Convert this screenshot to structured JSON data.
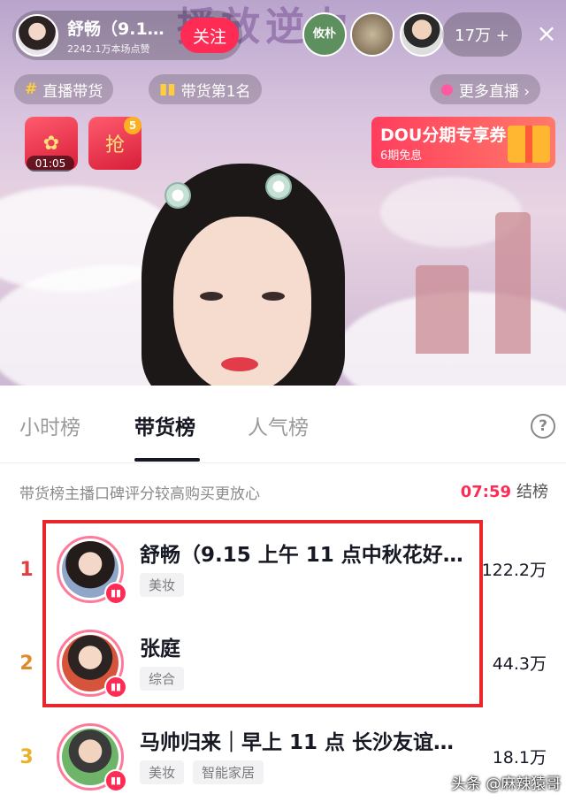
{
  "stream": {
    "banner_text": "播放逆力",
    "host": {
      "name": "舒畅（9.1…",
      "likes": "2242.1万本场点赞",
      "follow_label": "关注"
    },
    "viewer_badge": "攸朴",
    "viewer_count": "17万 +",
    "close_icon": "×",
    "chips": [
      {
        "icon": "#",
        "label": "直播带货"
      },
      {
        "icon": "▮▮",
        "label": "带货第1名"
      },
      {
        "icon": "●",
        "label": "更多直播 ›"
      }
    ],
    "gift_timer": "01:05",
    "gift_badge_count": "5",
    "gift2_label": "抢",
    "promo": {
      "title": "DOU分期专享券",
      "subtitle": "6期免息"
    }
  },
  "panel": {
    "tabs": [
      {
        "label": "小时榜"
      },
      {
        "label": "带货榜"
      },
      {
        "label": "人气榜"
      }
    ],
    "help_icon": "?",
    "subheading": "带货榜主播口碑评分较高购买更放心",
    "countdown_time": "07:59",
    "countdown_label": "结榜",
    "rows": [
      {
        "rank": "1",
        "name": "舒畅（9.15 上午 11 点中秋花好…",
        "tags": [
          "美妆"
        ],
        "metric": "122.2万"
      },
      {
        "rank": "2",
        "name": "张庭",
        "tags": [
          "综合"
        ],
        "metric": "44.3万"
      },
      {
        "rank": "3",
        "name": "马帅归来｜早上 11 点 长沙友谊…",
        "tags": [
          "美妆",
          "智能家居"
        ],
        "metric": "18.1万"
      }
    ]
  },
  "watermark": "头条 @麻辣猿哥",
  "colors": {
    "accent": "#fe2c55",
    "highlight_box": "#e8262c",
    "rank1": "#e2403f",
    "rank2": "#e08a2a",
    "rank3": "#e8b22a"
  }
}
